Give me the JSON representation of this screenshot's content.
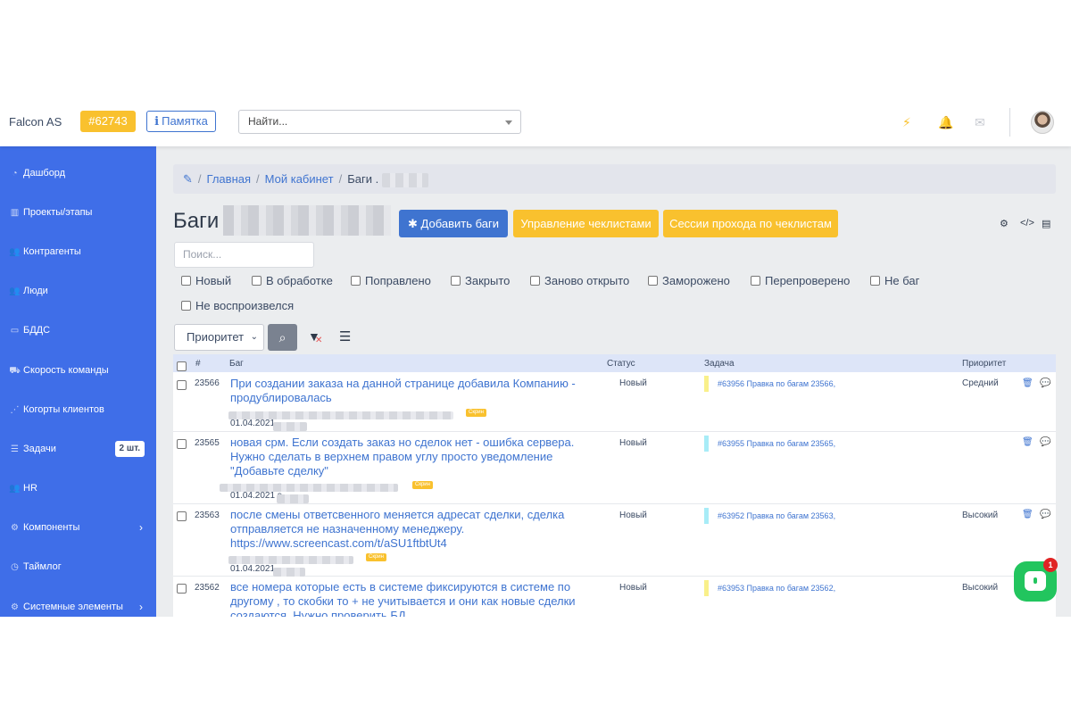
{
  "header": {
    "brand": "Falcon AS",
    "task_badge": "#62743",
    "memo_label": "Памятка",
    "search_placeholder": "Найти...",
    "icons": [
      "bolt-icon",
      "bell-icon",
      "mail-icon"
    ]
  },
  "sidebar": {
    "items": [
      {
        "label": "Дашборд",
        "icon": "dashboard-icon"
      },
      {
        "label": "Проекты/этапы",
        "icon": "projects-icon"
      },
      {
        "label": "Контрагенты",
        "icon": "users-icon"
      },
      {
        "label": "Люди",
        "icon": "people-icon"
      },
      {
        "label": "БДДС",
        "icon": "money-icon"
      },
      {
        "label": "Скорость команды",
        "icon": "truck-icon"
      },
      {
        "label": "Когорты клиентов",
        "icon": "cohorts-icon"
      },
      {
        "label": "Задачи",
        "icon": "tasks-icon",
        "badge": "2 шт."
      },
      {
        "label": "HR",
        "icon": "hr-icon"
      },
      {
        "label": "Компоненты",
        "icon": "components-icon",
        "chevron": true
      },
      {
        "label": "Таймлог",
        "icon": "clock-icon"
      },
      {
        "label": "Системные элементы",
        "icon": "system-icon",
        "chevron": true
      }
    ]
  },
  "breadcrumb": {
    "home": "Главная",
    "cabinet": "Мой кабинет",
    "current": "Баги ."
  },
  "page": {
    "title": "Баги",
    "add_button": "Добавить баги",
    "checklists_button": "Управление чеклистами",
    "sessions_button": "Сессии прохода по чеклистам",
    "search_placeholder": "Поиск..."
  },
  "filters": {
    "statuses": [
      "Новый",
      "В обработке",
      "Поправлено",
      "Закрыто",
      "Заново открыто",
      "Заморожено",
      "Перепроверено",
      "Не баг",
      "Не воспроизвелся"
    ],
    "priority_select": "Приоритет"
  },
  "table": {
    "headers": {
      "num": "#",
      "bug": "Баг",
      "status": "Статус",
      "task": "Задача",
      "priority": "Приоритет"
    },
    "rows": [
      {
        "id": "23566",
        "title": "При создании заказа на данной странице добавила Компанию - продублировалась",
        "date": "01.04.2021",
        "tag": "Скрин",
        "status": "Новый",
        "task": "#63956 Правка по багам 23566,",
        "task_color": "#f9f08a",
        "priority": "Средний"
      },
      {
        "id": "23565",
        "title": "новая срм. Если создать заказ но сделок нет - ошибка сервера. Нужно сделать в верхнем правом углу просто уведомление \"Добавьте сделку\"",
        "date": "01.04.2021 s",
        "tag": "Скрин",
        "status": "Новый",
        "task": "#63955 Правка по багам 23565,",
        "task_color": "#a8ecf7",
        "priority": ""
      },
      {
        "id": "23563",
        "title": "после смены ответсвенного меняется адресат сделки, сделка отправляется не назначенному менеджеру. https://www.screencast.com/t/aSU1ftbtUt4",
        "date": "01.04.2021",
        "tag": "Скрин",
        "status": "Новый",
        "task": "#63952 Правка по багам 23563,",
        "task_color": "#a8ecf7",
        "priority": "Высокий"
      },
      {
        "id": "23562",
        "title": "все номера которые есть в системе фиксируются в системе по другому , то скобки то + не учитывается и они как новые сделки создаются. Нужно проверить БД",
        "date": "",
        "tag": "",
        "status": "Новый",
        "task": "#63953 Правка по багам 23562,",
        "task_color": "#f9f08a",
        "priority": "Высокий"
      }
    ]
  },
  "chat": {
    "notifications": "1"
  }
}
